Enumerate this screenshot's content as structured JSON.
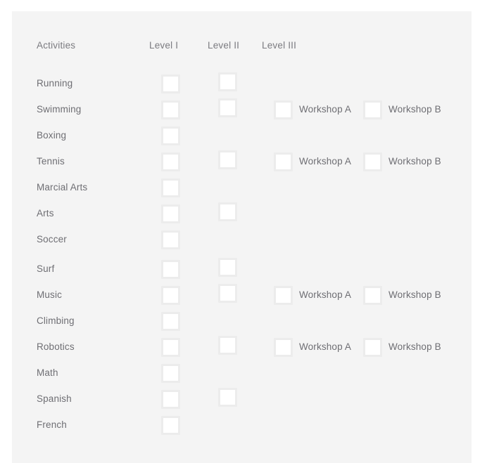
{
  "theme": {
    "page_background": "#ffffff",
    "panel_background": "#f4f4f4",
    "text_color": "#6e6e73",
    "header_text_color": "#7b7b80",
    "checkbox_fill": "#ffffff",
    "checkbox_border": "#ececec"
  },
  "headers": {
    "activities": "Activities",
    "level1": "Level I",
    "level2": "Level II",
    "level3": "Level III"
  },
  "workshop_labels": {
    "a": "Workshop A",
    "b": "Workshop B"
  },
  "rows": [
    {
      "activity": "Running",
      "level1": true,
      "level2": true,
      "level3": false,
      "gap_before": false
    },
    {
      "activity": "Swimming",
      "level1": true,
      "level2": true,
      "level3": true,
      "gap_before": false
    },
    {
      "activity": "Boxing",
      "level1": true,
      "level2": false,
      "level3": false,
      "gap_before": false
    },
    {
      "activity": "Tennis",
      "level1": true,
      "level2": true,
      "level3": true,
      "gap_before": false
    },
    {
      "activity": "Marcial Arts",
      "level1": true,
      "level2": false,
      "level3": false,
      "gap_before": false
    },
    {
      "activity": "Arts",
      "level1": true,
      "level2": true,
      "level3": false,
      "gap_before": false
    },
    {
      "activity": "Soccer",
      "level1": true,
      "level2": false,
      "level3": false,
      "gap_before": false
    },
    {
      "activity": "Surf",
      "level1": true,
      "level2": true,
      "level3": false,
      "gap_before": true
    },
    {
      "activity": "Music",
      "level1": true,
      "level2": true,
      "level3": true,
      "gap_before": false
    },
    {
      "activity": "Climbing",
      "level1": true,
      "level2": false,
      "level3": false,
      "gap_before": false
    },
    {
      "activity": "Robotics",
      "level1": true,
      "level2": true,
      "level3": true,
      "gap_before": false
    },
    {
      "activity": "Math",
      "level1": true,
      "level2": false,
      "level3": false,
      "gap_before": false
    },
    {
      "activity": "Spanish",
      "level1": true,
      "level2": true,
      "level3": false,
      "gap_before": false
    },
    {
      "activity": "French",
      "level1": true,
      "level2": false,
      "level3": false,
      "gap_before": false
    }
  ]
}
